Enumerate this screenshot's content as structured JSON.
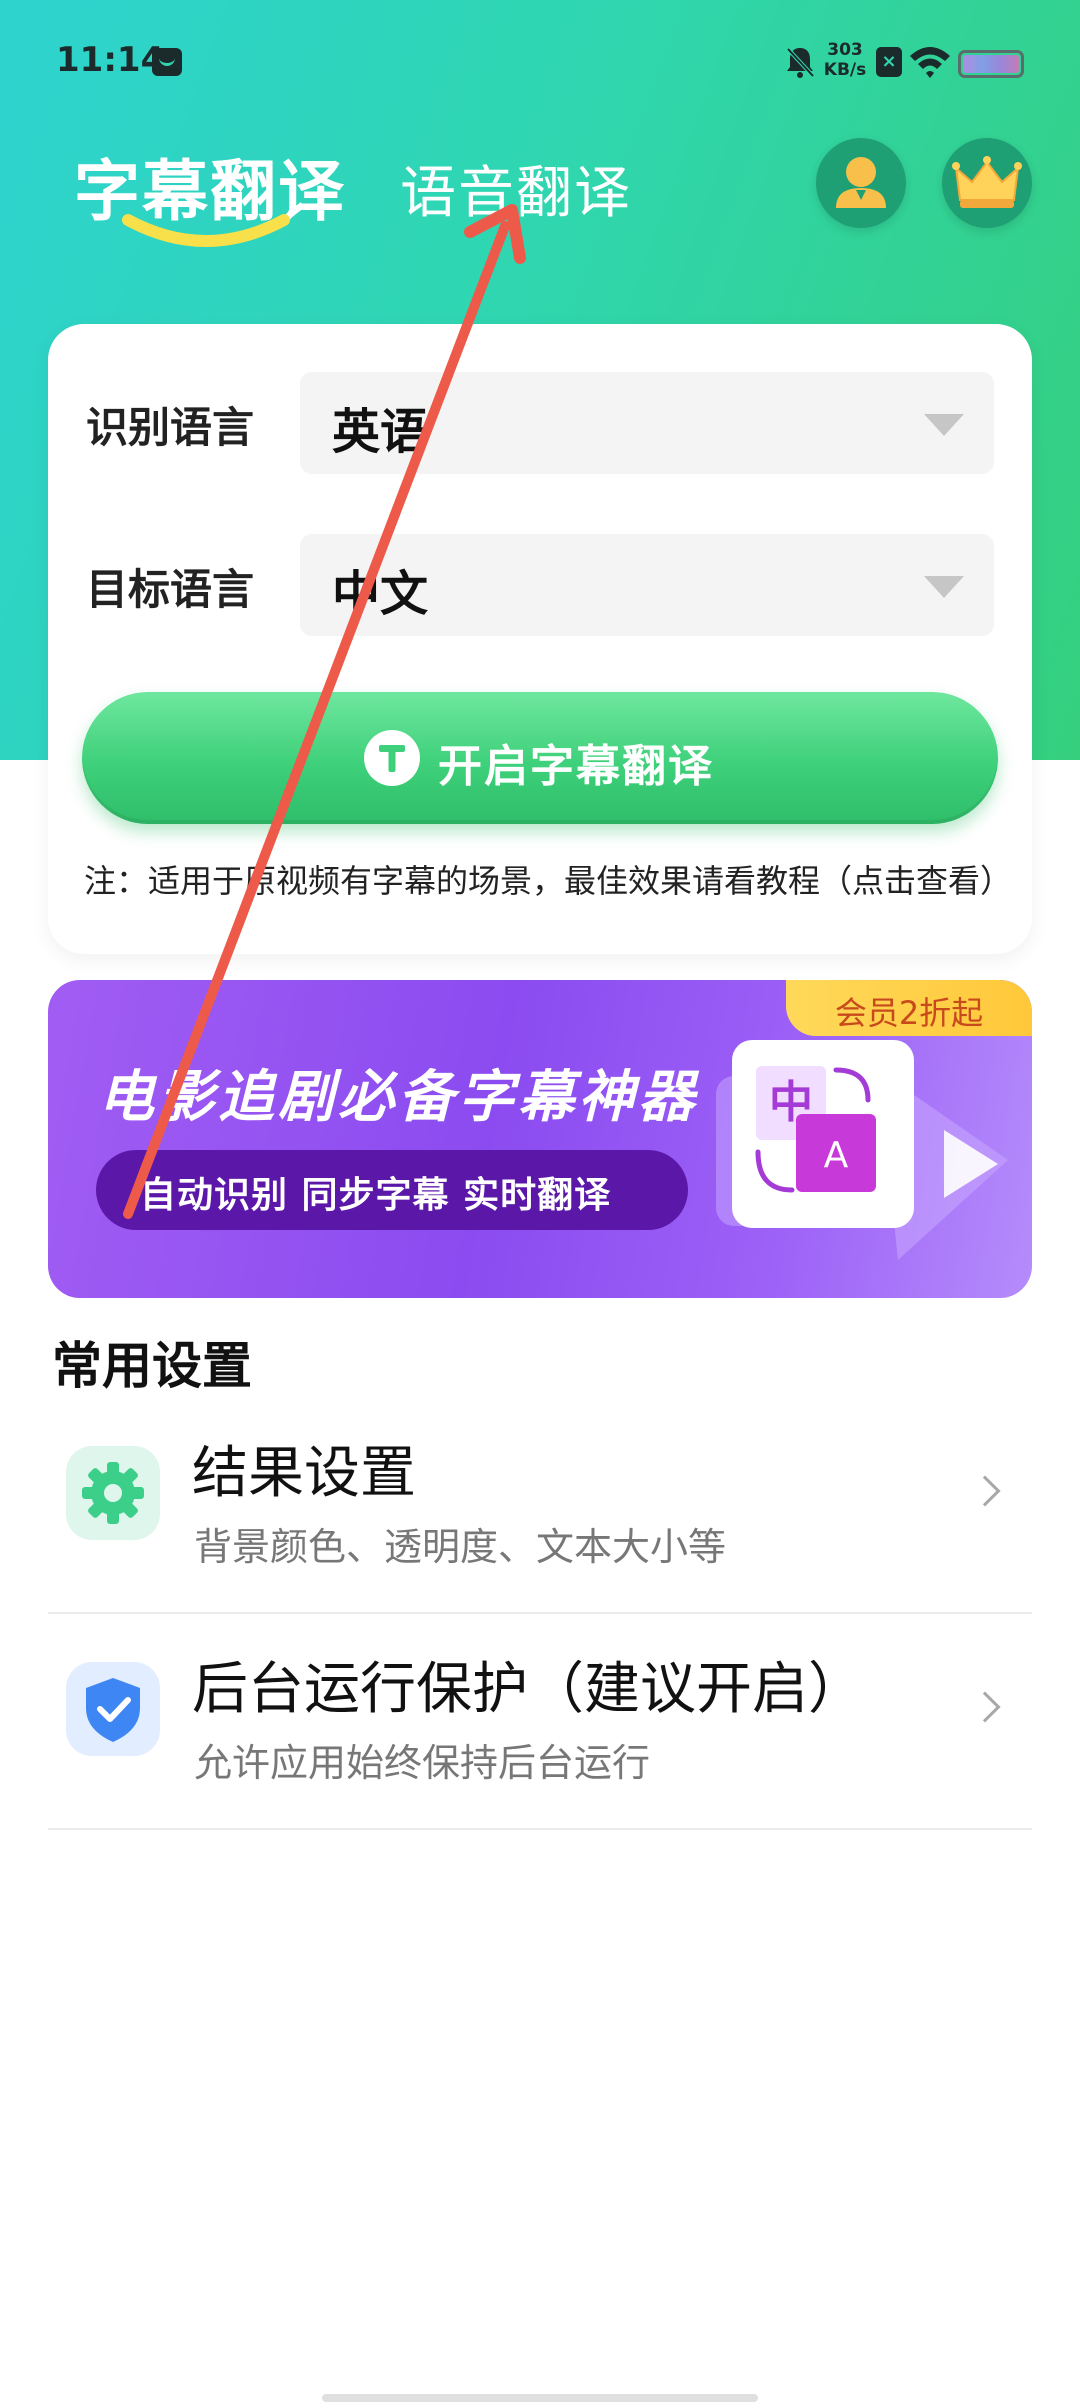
{
  "status_bar": {
    "time": "11:14",
    "net_speed_value": "303",
    "net_speed_unit": "KB/s"
  },
  "tabs": {
    "active": "字幕翻译",
    "inactive": "语音翻译"
  },
  "form": {
    "source_label": "识别语言",
    "source_value": "英语",
    "target_label": "目标语言",
    "target_value": "中文",
    "start_button": "开启字幕翻译",
    "note": "注：适用于原视频有字幕的场景，最佳效果请看教程（点击查看）"
  },
  "banner": {
    "badge": "会员2折起",
    "title": "电影追剧必备字幕神器",
    "pill": "自动识别 同步字幕 实时翻译",
    "art_zh": "中",
    "art_en": "A"
  },
  "settings": {
    "section_title": "常用设置",
    "items": [
      {
        "title": "结果设置",
        "subtitle": "背景颜色、透明度、文本大小等",
        "icon": "gear-icon"
      },
      {
        "title": "后台运行保护（建议开启）",
        "subtitle": "允许应用始终保持后台运行",
        "icon": "shield-check-icon"
      }
    ]
  },
  "colors": {
    "header_start": "#2ed3cf",
    "header_end": "#35cf7e",
    "start_button": "#3ed07a",
    "banner": "#8b4bf0",
    "badge": "#ffc83a",
    "annotation_arrow": "#ee5a4a"
  }
}
